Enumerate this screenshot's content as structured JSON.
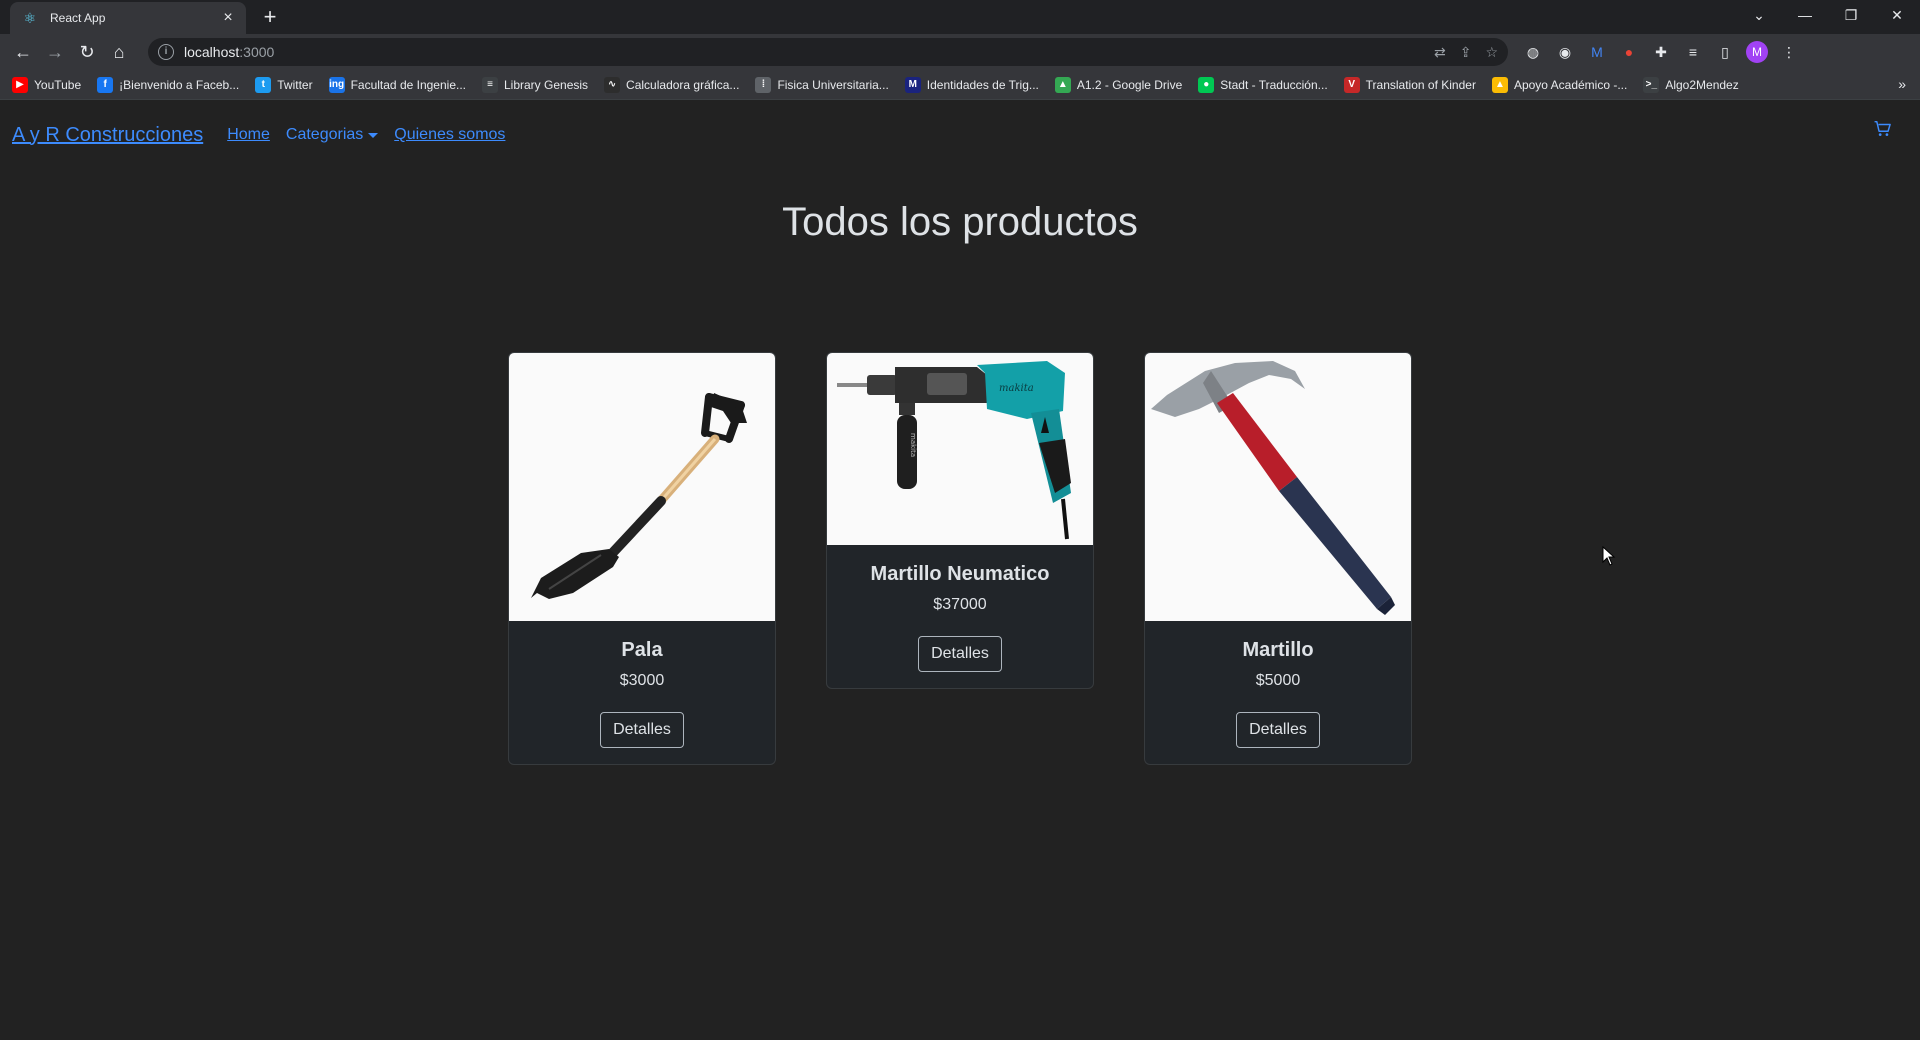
{
  "browser": {
    "tab_title": "React App",
    "url_host": "localhost",
    "url_port": ":3000",
    "bookmarks": [
      {
        "label": "YouTube",
        "icon": "youtube-icon",
        "color": "#ff0000",
        "glyph": "▶"
      },
      {
        "label": "¡Bienvenido a Faceb...",
        "icon": "facebook-icon",
        "color": "#1877f2",
        "glyph": "f"
      },
      {
        "label": "Twitter",
        "icon": "twitter-icon",
        "color": "#1d9bf0",
        "glyph": "t"
      },
      {
        "label": "Facultad de Ingenie...",
        "icon": "fiuba-icon",
        "color": "#1a73e8",
        "glyph": "ing"
      },
      {
        "label": "Library Genesis",
        "icon": "libgen-icon",
        "color": "#3c4043",
        "glyph": "≡"
      },
      {
        "label": "Calculadora gráfica...",
        "icon": "desmos-icon",
        "color": "#2d2d2d",
        "glyph": "∿"
      },
      {
        "label": "Fisica Universitaria...",
        "icon": "grid-icon",
        "color": "#5f6368",
        "glyph": "⁞"
      },
      {
        "label": "Identidades de Trig...",
        "icon": "m-icon",
        "color": "#1a237e",
        "glyph": "M"
      },
      {
        "label": "A1.2 - Google Drive",
        "icon": "drive-icon",
        "color": "#34a853",
        "glyph": "▲"
      },
      {
        "label": "Stadt - Traducción...",
        "icon": "dot-icon",
        "color": "#00c853",
        "glyph": "●"
      },
      {
        "label": "Translation of Kinder",
        "icon": "dict-icon",
        "color": "#c62828",
        "glyph": "V"
      },
      {
        "label": "Apoyo Académico -...",
        "icon": "drive-icon",
        "color": "#fbbc04",
        "glyph": "▲"
      },
      {
        "label": "Algo2Mendez",
        "icon": "terminal-icon",
        "color": "#3c4043",
        "glyph": ">_"
      }
    ],
    "avatar_letter": "M"
  },
  "nav": {
    "brand": "A y R Construcciones",
    "home": "Home",
    "categorias": "Categorias",
    "quienes": "Quienes somos"
  },
  "main": {
    "title": "Todos los productos",
    "products": [
      {
        "name": "Pala",
        "price": "$3000",
        "button": "Detalles",
        "image": "shovel-image"
      },
      {
        "name": "Martillo Neumatico",
        "price": "$37000",
        "button": "Detalles",
        "image": "rotary-hammer-image"
      },
      {
        "name": "Martillo",
        "price": "$5000",
        "button": "Detalles",
        "image": "hammer-image"
      }
    ]
  }
}
